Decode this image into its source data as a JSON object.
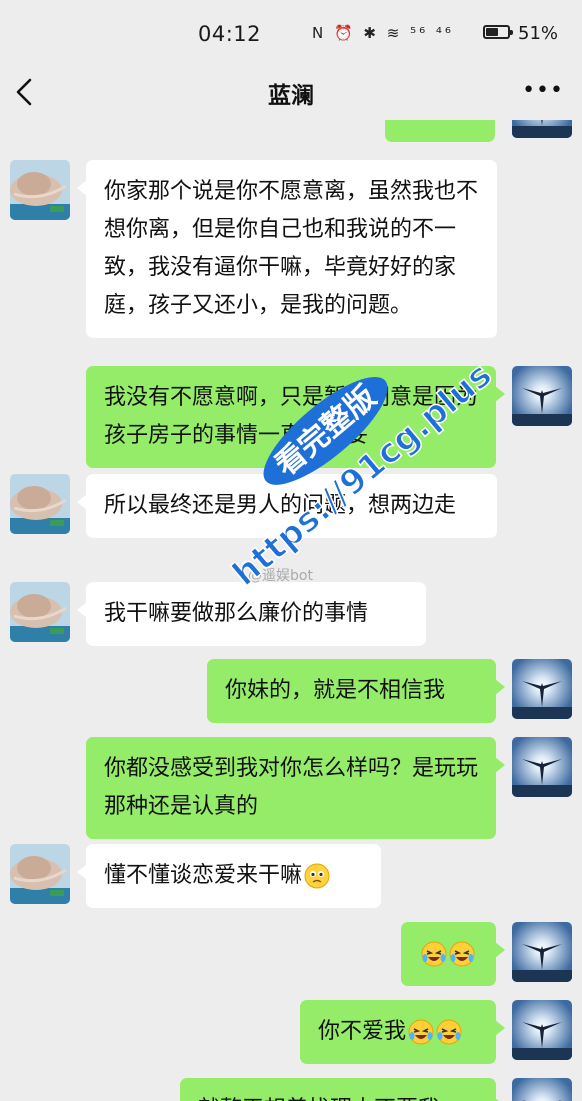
{
  "status_bar": {
    "time": "04:12",
    "icons": "N ⏰ ✱ ≋ ⁵⁶ ⁴⁶",
    "battery": "51%",
    "battery_level": 0.51
  },
  "header": {
    "title": "蓝澜",
    "more": "•••"
  },
  "colors": {
    "outgoing": "#95ec69",
    "incoming": "#ffffff",
    "background": "#ededed",
    "watermark": "#1f6fd8"
  },
  "messages": [
    {
      "side": "in",
      "text": "你家那个说是你不愿意离，虽然我也不想你离，但是你自己也和我说的不一致，我没有逼你干嘛，毕竟好好的家庭，孩子又还小，是我的问题。"
    },
    {
      "side": "out",
      "text": "我没有不愿意啊，只是暂不同意是因为孩子房子的事情一直没谈妥"
    },
    {
      "side": "in",
      "text": "所以最终还是男人的问题，想两边走"
    },
    {
      "side": "in",
      "text": "我干嘛要做那么廉价的事情"
    },
    {
      "side": "out",
      "text": "你妹的，就是不相信我"
    },
    {
      "side": "out",
      "text": "你都没感受到我对你怎么样吗？是玩玩那种还是认真的"
    },
    {
      "side": "in",
      "text": "懂不懂谈恋爱来干嘛",
      "emoji": "pleading-face"
    },
    {
      "side": "out",
      "text": "",
      "emoji": "crying-laughing x2"
    },
    {
      "side": "out",
      "text": "你不爱我",
      "emoji": "crying-laughing x2"
    },
    {
      "side": "out",
      "text": "就整天想着找理由不要我"
    }
  ],
  "watermark": {
    "line1": "看完整版",
    "line2": "https://91cg.plus",
    "weibo": "@遥娱bot"
  }
}
